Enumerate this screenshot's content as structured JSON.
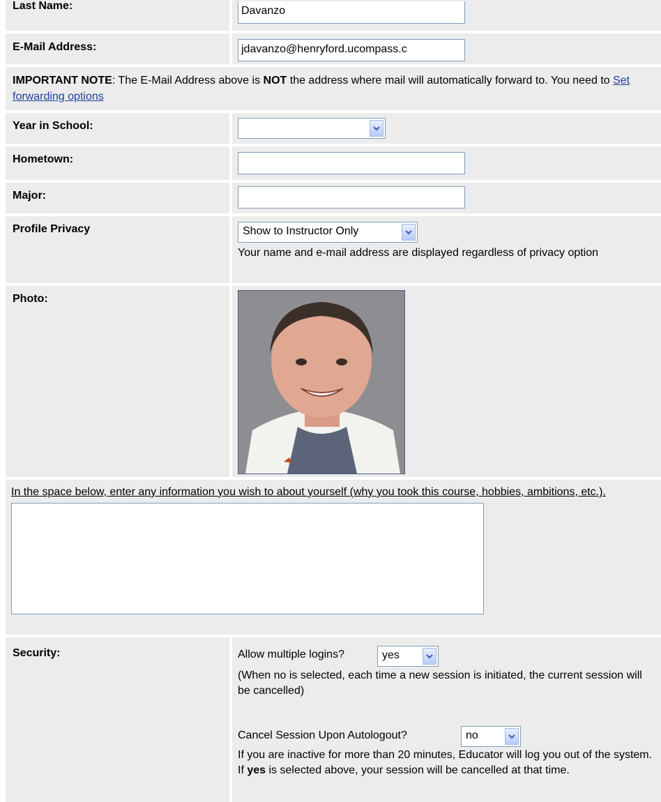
{
  "fields": {
    "last_name": {
      "label": "Last Name:",
      "value": "Davanzo"
    },
    "email": {
      "label": "E-Mail Address:",
      "value": "jdavanzo@henryford.ucompass.c"
    },
    "note": {
      "strong": "IMPORTANT NOTE",
      "text_a": ": The E-Mail Address above is ",
      "not": "NOT",
      "text_b": " the address where mail will automatically forward to. You need to ",
      "link": "Set forwarding options"
    },
    "year": {
      "label": "Year in School:",
      "value": ""
    },
    "hometown": {
      "label": "Hometown:",
      "value": ""
    },
    "major": {
      "label": "Major:",
      "value": ""
    },
    "privacy": {
      "label": "Profile Privacy",
      "selected": "Show to Instructor Only",
      "help": "Your name and e-mail address are displayed regardless of privacy option"
    },
    "photo": {
      "label": "Photo:"
    },
    "about": {
      "prompt": "In the space below, enter any information you wish to about yourself (why you took this course, hobbies, ambitions, etc.).",
      "value": ""
    },
    "security": {
      "label": "Security:",
      "multi_label": "Allow multiple logins?",
      "multi_value": "yes",
      "multi_help": "(When no is selected, each time a new session is initiated, the current session will be cancelled)",
      "cancel_label": "Cancel Session Upon Autologout?",
      "cancel_value": "no",
      "cancel_help_a": "If you are inactive for more than 20 minutes, Educator will log you out of the system. If ",
      "cancel_help_yes": "yes",
      "cancel_help_b": " is selected above, your session will be cancelled at that time."
    }
  },
  "colors": {
    "row_bg": "#ececec",
    "link": "#1e3f9a",
    "input_border": "#7f9db9"
  }
}
